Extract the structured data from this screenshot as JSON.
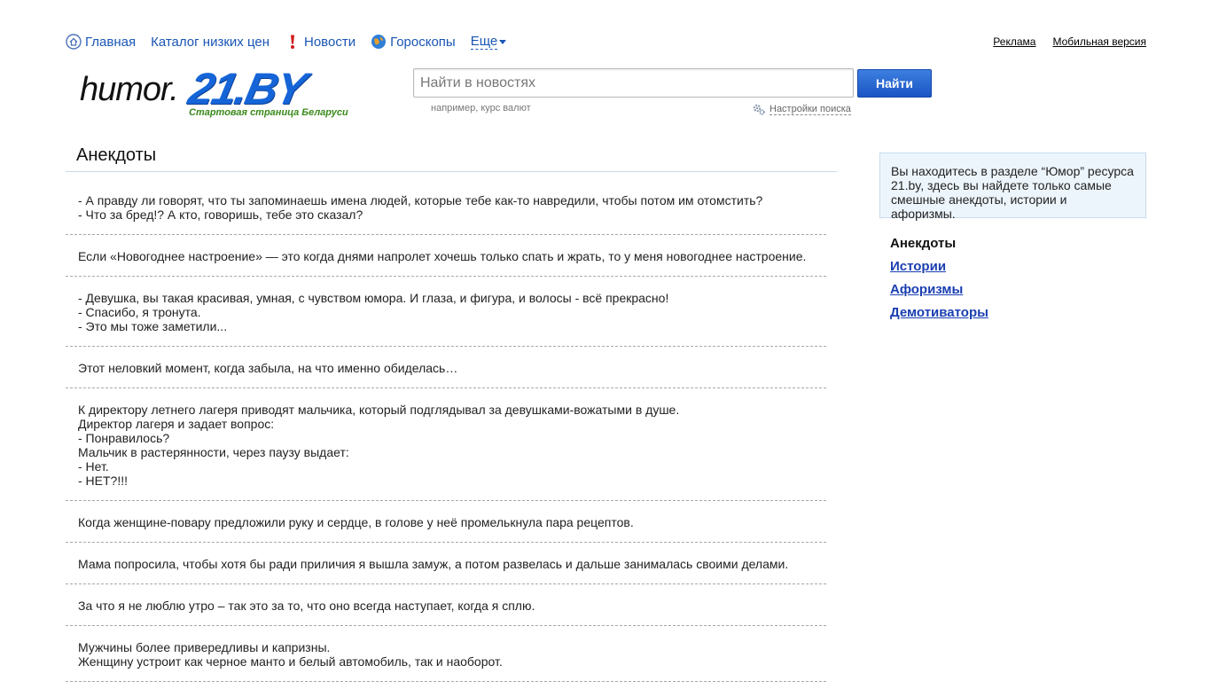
{
  "nav": {
    "items": [
      {
        "label": "Главная",
        "icon": "home-icon"
      },
      {
        "label": "Каталог низких цен",
        "icon": ""
      },
      {
        "label": "Новости",
        "icon": "exclamation-icon"
      },
      {
        "label": "Гороскопы",
        "icon": "globe-icon"
      }
    ],
    "more_label": "Еще"
  },
  "top_links": {
    "ads": "Реклама",
    "mobile": "Мобильная версия"
  },
  "logo": {
    "humor": "humor.",
    "brand": "21.BY",
    "tagline": "Стартовая страница Беларуси"
  },
  "search": {
    "placeholder": "Найти в новостях",
    "button_label": "Найти",
    "hint": "например, курс валют",
    "settings_label": "Настройки поиска"
  },
  "page": {
    "title": "Анекдоты"
  },
  "jokes": [
    [
      "- А правду ли говорят, что ты запоминаешь имена людей, которые тебе как-то навредили, чтобы потом им отомстить?",
      "- Что за бред!? А кто, говоришь, тебе это сказал?"
    ],
    [
      "Если «Новогоднее настроение» — это когда днями напролет хочешь только спать и жрать, то у меня новогоднее настроение."
    ],
    [
      "- Девушка, вы такая красивая, умная, с чувством юмора. И глаза, и фигура, и волосы - всё прекрасно!",
      "- Спасибо, я тронута.",
      "- Это мы тоже заметили..."
    ],
    [
      "Этот неловкий момент, когда забыла, на что именно обиделась…"
    ],
    [
      "К директору летнего лагеря приводят мальчика, который подглядывал за девушками-вожатыми в душе.",
      "Директор лагеря и задает вопрос:",
      "- Понравилось?",
      "Мальчик в растерянности, через паузу выдает:",
      "- Нет.",
      "- НЕТ?!!!"
    ],
    [
      "Когда женщине-повару предложили руку и сердце, в голове у неё промелькнула пара рецептов."
    ],
    [
      "Мама попросила, чтобы хотя бы ради приличия я вышла замуж, а потом развелась и дальше занималась своими делами."
    ],
    [
      "За что я не люблю утро – так это за то, что оно всегда наступает, когда я сплю."
    ],
    [
      "Мужчины более привередливы и капризны.",
      "Женщину устроит как черное манто и белый автомобиль, так и наоборот."
    ]
  ],
  "sidebar": {
    "info": "Вы находитесь в разделе “Юмор” ресурса 21.by, здесь вы найдете только самые смешные анекдоты, истории и афоризмы.",
    "menu": {
      "current": "Анекдоты",
      "links": [
        "Истории",
        "Афоризмы",
        "Демотиваторы"
      ]
    }
  },
  "colors": {
    "link": "#1a56b4",
    "brand": "#1565d8",
    "tagline": "#3a8a1c",
    "button": "#1a55c4"
  }
}
